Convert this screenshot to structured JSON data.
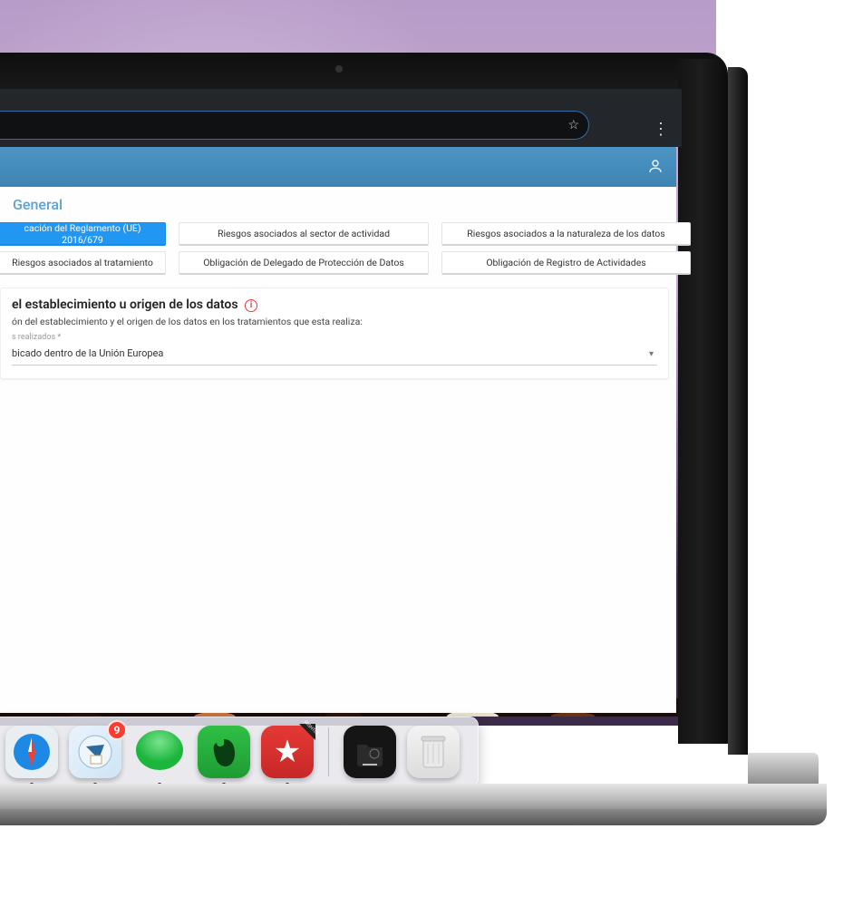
{
  "breadcrumb": "General",
  "tabs": {
    "r1c1": "cación del Reglamento (UE) 2016/679",
    "r1c2": "Riesgos asociados al sector de actividad",
    "r1c3": "Riesgos asociados a la naturaleza de los datos",
    "r2c1": "Riesgos asociados al tratamiento",
    "r2c2": "Obligación de Delegado de Protección de Datos",
    "r2c3": "Obligación de Registro de Actividades"
  },
  "card": {
    "title": "el establecimiento u origen de los datos",
    "help": "ón del establecimiento y el origen de los datos en los tratamientos que esta realiza:",
    "field_label": "s realizados *",
    "select_value": "bicado dentro de la Unión Europea"
  },
  "dock": {
    "mail_badge": "9",
    "wunder_ribbon": "NIGHTLY",
    "apps": [
      "safari",
      "mail",
      "messages",
      "evernote",
      "wunderlist",
      "darkfile",
      "trash"
    ]
  }
}
